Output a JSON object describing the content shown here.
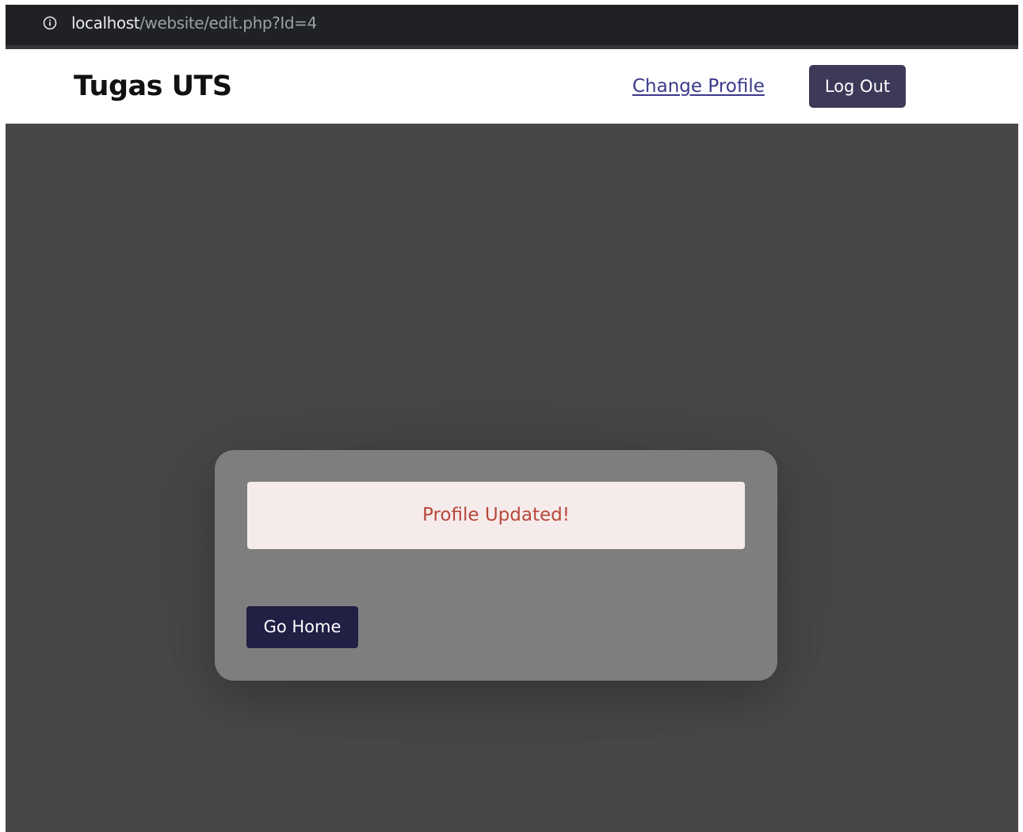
{
  "browser": {
    "url_host": "localhost",
    "url_path": "/website/edit.php?Id=4",
    "info_icon": "info-circle-icon"
  },
  "navbar": {
    "brand": "Tugas UTS",
    "change_profile_label": "Change Profile",
    "logout_label": "Log Out"
  },
  "card": {
    "alert_message": "Profile Updated!",
    "go_home_label": "Go Home"
  },
  "colors": {
    "page_background": "#474747",
    "card_background": "#7e7e7e",
    "alert_background": "#f6ebeb",
    "alert_text": "#b8473b",
    "logout_button": "#3c3a58",
    "home_button": "#221f45",
    "link": "#3a3a8a"
  }
}
